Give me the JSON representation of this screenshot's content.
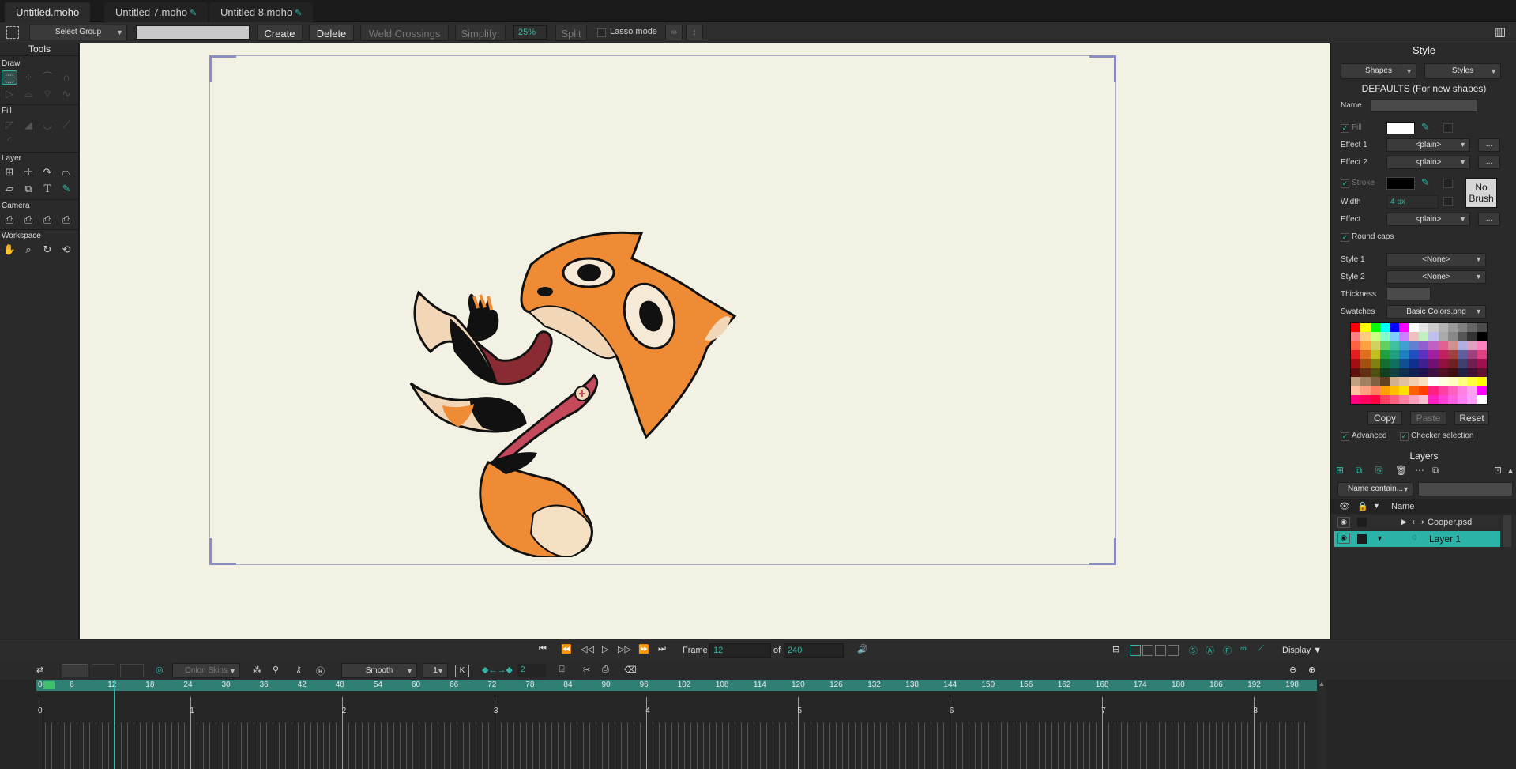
{
  "tabs": [
    {
      "label": "Untitled.moho",
      "modified": false
    },
    {
      "label": "Untitled 7.moho",
      "modified": true
    },
    {
      "label": "Untitled 8.moho",
      "modified": true
    }
  ],
  "toolbar": {
    "select_group": "Select Group",
    "create": "Create",
    "delete": "Delete",
    "weld": "Weld Crossings",
    "simplify": "Simplify:",
    "simplify_value": "25%",
    "split": "Split",
    "lasso": "Lasso mode"
  },
  "tools": {
    "title": "Tools",
    "sections": [
      "Draw",
      "Fill",
      "Layer",
      "Camera",
      "Workspace"
    ]
  },
  "style": {
    "title": "Style",
    "shapes": "Shapes",
    "styles": "Styles",
    "defaults": "DEFAULTS (For new shapes)",
    "name": "Name",
    "fill": "Fill",
    "effect1": "Effect 1",
    "effect1_value": "<plain>",
    "effect2": "Effect 2",
    "effect2_value": "<plain>",
    "stroke": "Stroke",
    "width": "Width",
    "width_value": "4 px",
    "effect": "Effect",
    "effect_value": "<plain>",
    "no_brush": "No Brush",
    "round_caps": "Round caps",
    "style1": "Style 1",
    "style1_value": "<None>",
    "style2": "Style 2",
    "style2_value": "<None>",
    "thickness": "Thickness",
    "swatches": "Swatches",
    "swatches_value": "Basic Colors.png",
    "copy": "Copy",
    "paste": "Paste",
    "reset": "Reset",
    "advanced": "Advanced",
    "checker": "Checker selection",
    "ellipsis": "..."
  },
  "layers": {
    "title": "Layers",
    "filter": "Name contain...",
    "name_col": "Name",
    "items": [
      {
        "name": "Cooper.psd",
        "selected": false
      },
      {
        "name": "Layer 1",
        "selected": true
      }
    ]
  },
  "transport": {
    "frame_label": "Frame",
    "frame_value": "12",
    "of_label": "of",
    "of_value": "240",
    "display": "Display"
  },
  "timeline": {
    "onion": "Onion Skins",
    "interp": "Smooth",
    "interp_n": "1",
    "key_n": "2",
    "ruler": [
      "0",
      "6",
      "12",
      "18",
      "24",
      "30",
      "36",
      "42",
      "48",
      "54",
      "60",
      "66",
      "72",
      "78",
      "84",
      "90",
      "96",
      "102",
      "108",
      "114",
      "120",
      "126",
      "132",
      "138",
      "144",
      "150",
      "156",
      "162",
      "168",
      "174",
      "180",
      "186",
      "192",
      "198"
    ],
    "seconds": [
      "0",
      "1",
      "2",
      "3",
      "4",
      "5",
      "6",
      "7",
      "8"
    ]
  },
  "colors": {
    "accent": "#2fb8a8",
    "selected_layer": "#2ab3a6"
  }
}
